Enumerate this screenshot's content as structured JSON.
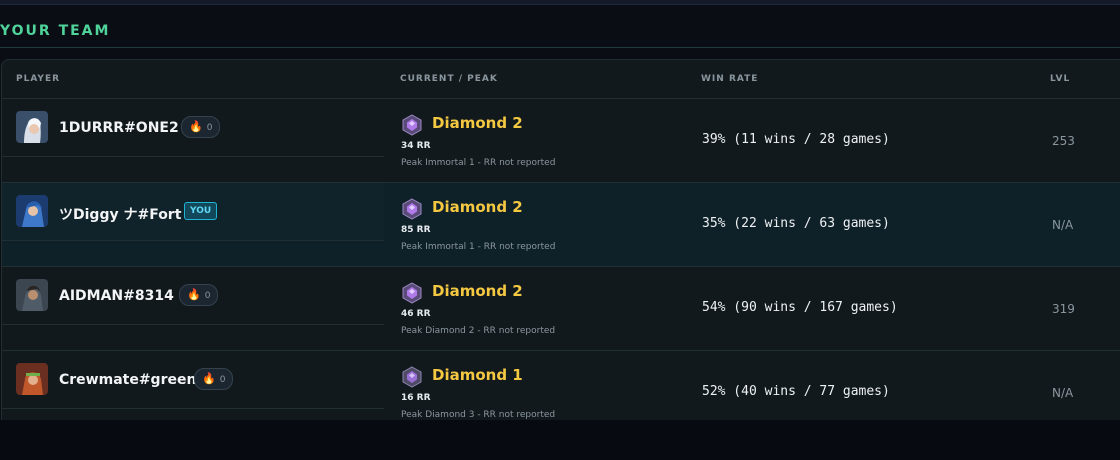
{
  "section_title": "YOUR TEAM",
  "columns": {
    "player": "PLAYER",
    "rank": "CURRENT / PEAK",
    "winrate": "WIN RATE",
    "level": "LVL"
  },
  "players": [
    {
      "name": "1DURRR#ONE2",
      "streak": "0",
      "badge": "",
      "rank": "Diamond 2",
      "rr": "34 RR",
      "peak": "Peak Immortal 1 - RR not reported",
      "winrate": "39% (11 wins / 28 games)",
      "level": "253"
    },
    {
      "name": "ツDiggy ナ#Fort",
      "streak": "",
      "badge": "YOU",
      "rank": "Diamond 2",
      "rr": "85 RR",
      "peak": "Peak Immortal 1 - RR not reported",
      "winrate": "35% (22 wins / 63 games)",
      "level": "N/A"
    },
    {
      "name": "AIDMAN#8314",
      "streak": "0",
      "badge": "",
      "rank": "Diamond 2",
      "rr": "46 RR",
      "peak": "Peak Diamond 2 - RR not reported",
      "winrate": "54% (90 wins / 167 games)",
      "level": "319"
    },
    {
      "name": "Crewmate#green",
      "streak": "0",
      "badge": "",
      "rank": "Diamond 1",
      "rr": "16 RR",
      "peak": "Peak Diamond 3 - RR not reported",
      "winrate": "52% (40 wins / 77 games)",
      "level": "N/A"
    }
  ],
  "colors": {
    "accent": "#4fd39a",
    "rank_gold": "#f5c842",
    "you_badge": "#1fb4d6",
    "streak_flame": "#ff8a2a",
    "diamond_gem": "#b07be8"
  },
  "icons": {
    "streak": "flame-icon",
    "rank": "diamond-rank-icon",
    "avatar": "agent-avatar"
  }
}
